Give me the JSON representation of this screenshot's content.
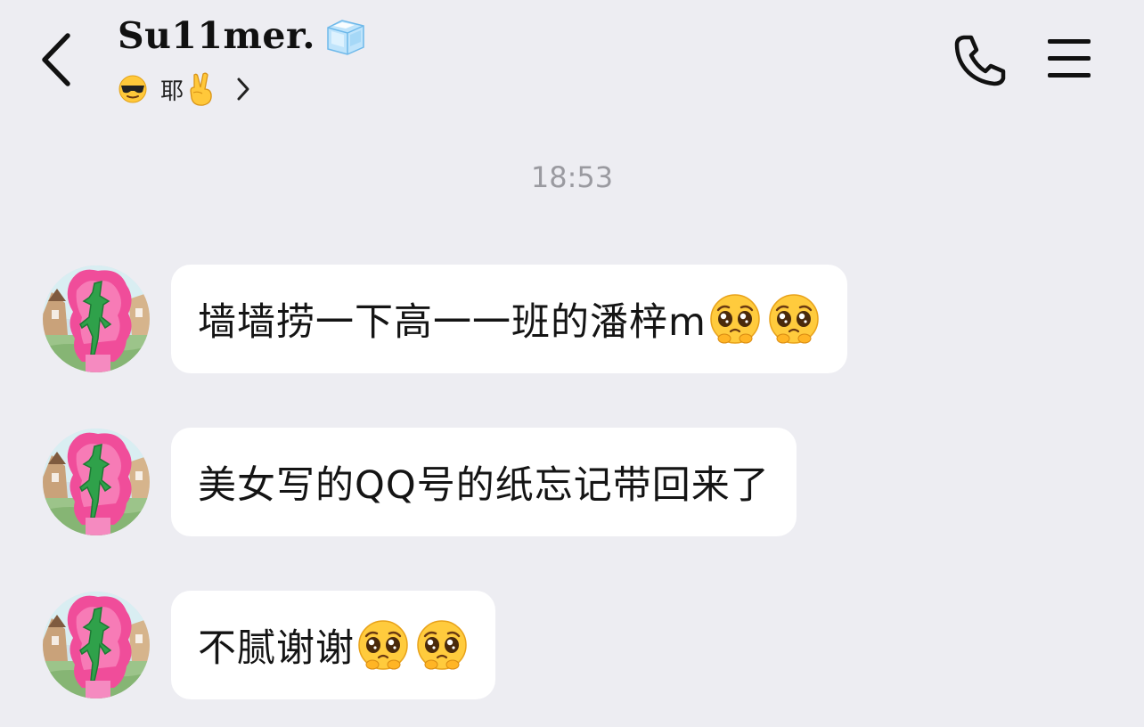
{
  "header": {
    "back_icon": "chevron-left-icon",
    "contact_name": "Su11mer.",
    "name_badge_icon": "ice-cube-icon",
    "status": {
      "leading_icon": "sunglasses-emoji-icon",
      "text": "耶",
      "trailing_icon": "victory-hand-emoji-icon",
      "chevron_icon": "chevron-right-icon"
    },
    "call_icon": "phone-icon",
    "menu_icon": "hamburger-menu-icon"
  },
  "time_divider": "18:53",
  "messages": [
    {
      "sender": "contact",
      "avatar_icon": "avatar-pony-image",
      "text": "墙墙捞一下高一一班的潘梓m",
      "trailing_emojis": [
        "pleading-face-emoji",
        "pleading-face-emoji"
      ]
    },
    {
      "sender": "contact",
      "avatar_icon": "avatar-pony-image",
      "text": "美女写的QQ号的纸忘记带回来了",
      "trailing_emojis": []
    },
    {
      "sender": "contact",
      "avatar_icon": "avatar-pony-image",
      "text": "不腻谢谢",
      "trailing_emojis": [
        "pleading-face-emoji",
        "pleading-face-emoji"
      ]
    }
  ],
  "colors": {
    "background": "#ededf2",
    "bubble": "#ffffff",
    "text": "#141414",
    "timestamp": "#9a9aa0"
  }
}
